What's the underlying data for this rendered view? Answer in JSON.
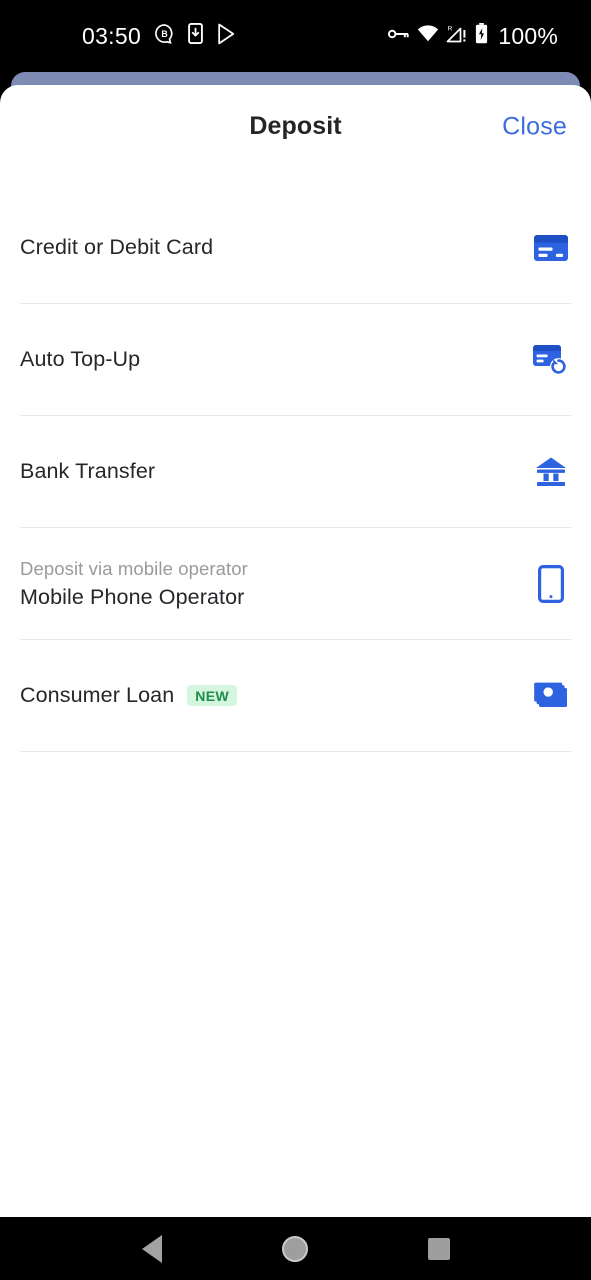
{
  "status_bar": {
    "clock": "03:50",
    "battery_percent": "100%",
    "left_icons": [
      "messaging-bubble-b-icon",
      "phone-download-icon",
      "play-store-icon"
    ],
    "right_icons": [
      "vpn-key-icon",
      "wifi-icon",
      "cellular-roaming-signal-icon",
      "battery-charging-icon"
    ]
  },
  "sheet": {
    "title": "Deposit",
    "close_label": "Close",
    "accent_color": "#3d6ce0",
    "icon_color": "#2d62e0",
    "title_color": "#252525"
  },
  "options": [
    {
      "subtitle": "",
      "title": "Credit or Debit Card",
      "badge": "",
      "icon": "credit-card-icon"
    },
    {
      "subtitle": "",
      "title": "Auto Top-Up",
      "badge": "",
      "icon": "credit-card-refresh-icon"
    },
    {
      "subtitle": "",
      "title": "Bank Transfer",
      "badge": "",
      "icon": "bank-building-icon"
    },
    {
      "subtitle": "Deposit via mobile operator",
      "title": "Mobile Phone Operator",
      "badge": "",
      "icon": "smartphone-icon"
    },
    {
      "subtitle": "",
      "title": "Consumer Loan",
      "badge": "NEW",
      "icon": "banknote-stack-icon"
    }
  ],
  "badge_colors": {
    "new_background": "#d4f5de",
    "new_text": "#1e8e4a"
  },
  "nav_bar": {
    "back_label": "Back",
    "home_label": "Home",
    "recents_label": "Recents"
  }
}
